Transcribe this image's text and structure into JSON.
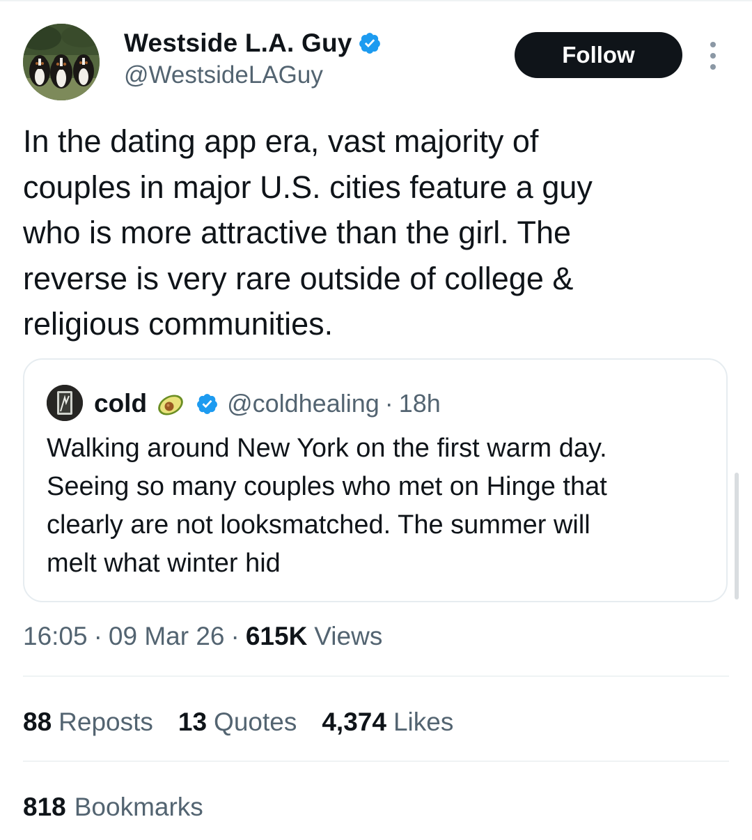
{
  "author": {
    "display_name": "Westside L.A. Guy",
    "handle": "@WestsideLAGuy",
    "verified_badge_icon": "verified-badge-icon",
    "avatar_icon": "avatar-dogs-photo"
  },
  "follow_button": {
    "label": "Follow"
  },
  "more_icon": "more-vertical-icon",
  "tweet": {
    "text": "In the dating app era, vast majority of\ncouples in major U.S. cities feature a guy\nwho is more attractive than the girl. The\nreverse is very rare outside of college &\nreligious communities."
  },
  "quote": {
    "display_name": "cold",
    "emoji_icon": "avocado-emoji-icon",
    "verified_badge_icon": "verified-badge-icon",
    "handle": "@coldhealing",
    "separator": "·",
    "time": "18h",
    "text": "Walking around New York on the first warm day.\nSeeing so many couples who met on Hinge that\nclearly are not looksmatched. The summer will\nmelt what winter hid"
  },
  "meta": {
    "time": "16:05",
    "separator": "·",
    "date": "09 Mar 26",
    "views_count": "615K",
    "views_label": "Views"
  },
  "stats": {
    "reposts_count": "88",
    "reposts_label": "Reposts",
    "quotes_count": "13",
    "quotes_label": "Quotes",
    "likes_count": "4,374",
    "likes_label": "Likes",
    "bookmarks_count": "818",
    "bookmarks_label": "Bookmarks"
  },
  "colors": {
    "text_primary": "#0f1419",
    "text_secondary": "#536471",
    "verified_blue": "#1d9bf0",
    "follow_bg": "#0f1419",
    "border": "#e6ecf0"
  }
}
